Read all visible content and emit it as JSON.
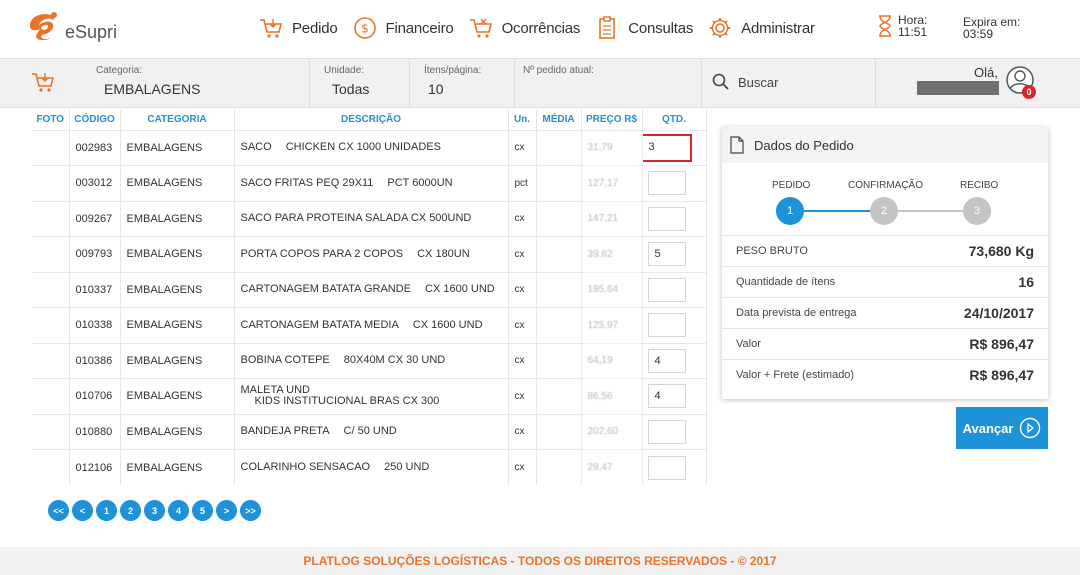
{
  "brand": {
    "name": "eSupri"
  },
  "nav": {
    "items": [
      {
        "label": "Pedido",
        "icon": "cart-icon"
      },
      {
        "label": "Financeiro",
        "icon": "dollar-icon"
      },
      {
        "label": "Ocorrências",
        "icon": "cart-x-icon"
      },
      {
        "label": "Consultas",
        "icon": "clipboard-icon"
      },
      {
        "label": "Administrar",
        "icon": "gear-icon"
      }
    ]
  },
  "clock": {
    "label": "Hora:",
    "time": "11:51"
  },
  "session": {
    "label": "Expira em:",
    "time": "03:59"
  },
  "filters": {
    "categoria_label": "Categoria:",
    "categoria": "EMBALAGENS",
    "unidade_label": "Unidade:",
    "unidade": "Todas",
    "itens_label": "Ítens/página:",
    "itens": "10",
    "pedido_label": "Nº pedido atual:",
    "pedido": ""
  },
  "search": {
    "label": "Buscar"
  },
  "user": {
    "greeting": "Olá,",
    "notifications": "0"
  },
  "table": {
    "headers": [
      "FOTO",
      "CÓDIGO",
      "CATEGORIA",
      "DESCRIÇÃO",
      "Un.",
      "MÉDIA",
      "PREÇO R$",
      "QTD."
    ],
    "rows": [
      {
        "codigo": "002983",
        "categoria": "EMBALAGENS",
        "desc_a": "SACO",
        "desc_b": "CHICKEN CX 1000 UNIDADES",
        "un": "cx",
        "media": "",
        "preco": "31,79",
        "qtd": "3"
      },
      {
        "codigo": "003012",
        "categoria": "EMBALAGENS",
        "desc_a": "SACO FRITAS PEQ 29X11",
        "desc_b": "PCT 6000UN",
        "un": "pct",
        "media": "",
        "preco": "127,17",
        "qtd": ""
      },
      {
        "codigo": "009267",
        "categoria": "EMBALAGENS",
        "desc_a": "SACO PARA PROTEINA SALADA CX 500UND",
        "desc_b": "",
        "un": "cx",
        "media": "",
        "preco": "147,21",
        "qtd": ""
      },
      {
        "codigo": "009793",
        "categoria": "EMBALAGENS",
        "desc_a": "PORTA COPOS PARA 2 COPOS",
        "desc_b": "CX 180UN",
        "un": "cx",
        "media": "",
        "preco": "39,62",
        "qtd": "5"
      },
      {
        "codigo": "010337",
        "categoria": "EMBALAGENS",
        "desc_a": "CARTONAGEM BATATA GRANDE",
        "desc_b": "CX 1600 UND",
        "un": "cx",
        "media": "",
        "preco": "195,64",
        "qtd": ""
      },
      {
        "codigo": "010338",
        "categoria": "EMBALAGENS",
        "desc_a": "CARTONAGEM BATATA MEDIA",
        "desc_b": "CX 1600 UND",
        "un": "cx",
        "media": "",
        "preco": "125,97",
        "qtd": ""
      },
      {
        "codigo": "010386",
        "categoria": "EMBALAGENS",
        "desc_a": "BOBINA COTEPE",
        "desc_b": "80X40M CX 30 UND",
        "un": "cx",
        "media": "",
        "preco": "64,19",
        "qtd": "4"
      },
      {
        "codigo": "010706",
        "categoria": "EMBALAGENS",
        "desc_a": "MALETA UND",
        "desc_b": "KIDS INSTITUCIONAL BRAS CX 300",
        "un": "cx",
        "media": "",
        "preco": "86,56",
        "qtd": "4"
      },
      {
        "codigo": "010880",
        "categoria": "EMBALAGENS",
        "desc_a": "BANDEJA PRETA",
        "desc_b": "C/ 50 UND",
        "un": "cx",
        "media": "",
        "preco": "202,60",
        "qtd": ""
      },
      {
        "codigo": "012106",
        "categoria": "EMBALAGENS",
        "desc_a": "COLARINHO SENSACAO",
        "desc_b": "250 UND",
        "un": "cx",
        "media": "",
        "preco": "29,47",
        "qtd": ""
      }
    ]
  },
  "pager": {
    "first": "<<",
    "prev": "<",
    "pages": [
      "1",
      "2",
      "3",
      "4",
      "5"
    ],
    "next": ">",
    "last": ">>"
  },
  "panel": {
    "title": "Dados do Pedido",
    "steps": [
      {
        "label": "PEDIDO",
        "num": "1"
      },
      {
        "label": "CONFIRMAÇÃO",
        "num": "2"
      },
      {
        "label": "RECIBO",
        "num": "3"
      }
    ],
    "rows": [
      {
        "key": "PESO BRUTO",
        "value": "73,680 Kg"
      },
      {
        "key": "Quantidade de ítens",
        "value": "16"
      },
      {
        "key": "Data prevista de entrega",
        "value": "24/10/2017"
      },
      {
        "key": "Valor",
        "value": "R$ 896,47"
      },
      {
        "key": "Valor + Frete (estimado)",
        "value": "R$ 896,47"
      }
    ]
  },
  "actions": {
    "avancar": "Avançar"
  },
  "footer": {
    "text": "PLATLOG SOLUÇÕES LOGÍSTICAS - TODOS OS DIREITOS RESERVADOS - © 2017"
  },
  "colors": {
    "accent": "#1e92d8",
    "brand": "#e8742a",
    "active_border": "#d9262b"
  }
}
